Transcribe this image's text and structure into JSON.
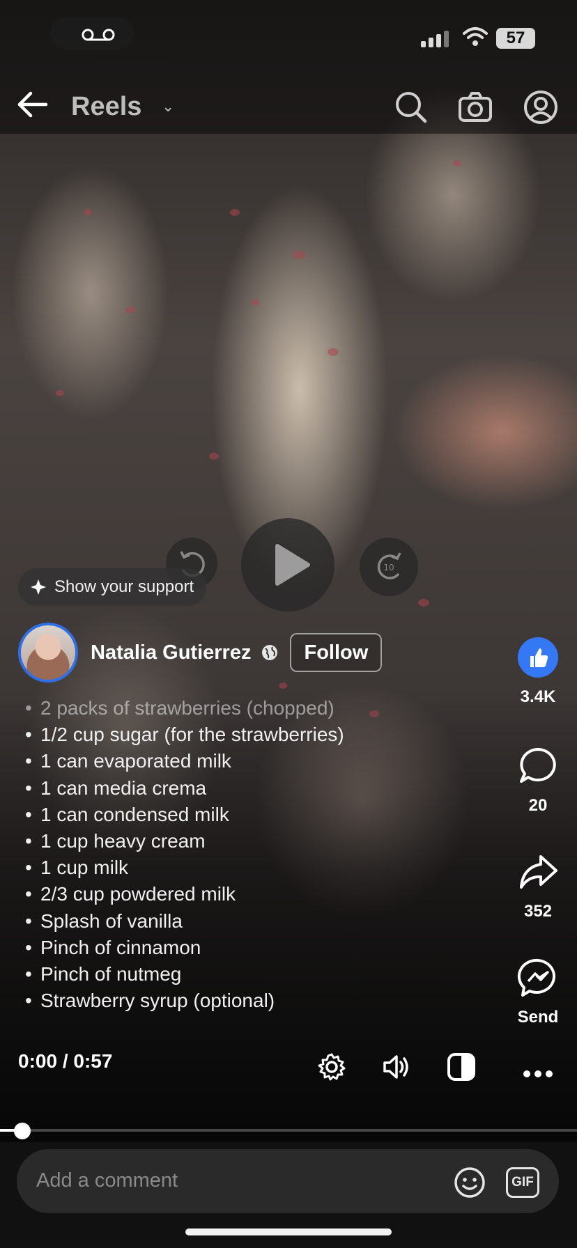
{
  "status_bar": {
    "battery": "57"
  },
  "header": {
    "title": "Reels",
    "caret": "⌄"
  },
  "support": {
    "label": "Show your support"
  },
  "author": {
    "name": "Natalia Gutierrez",
    "follow_label": "Follow"
  },
  "ingredients": [
    "2 packs of strawberries (chopped)",
    "1/2 cup sugar (for the strawberries)",
    "1 can evaporated milk",
    "1 can media crema",
    "1 can condensed milk",
    "1 cup heavy cream",
    "1 cup milk",
    "2/3 cup powdered milk",
    "Splash of vanilla",
    "Pinch of cinnamon",
    "Pinch of nutmeg",
    "Strawberry syrup (optional)"
  ],
  "bullet": "•",
  "rail": {
    "likes": "3.4K",
    "comments": "20",
    "shares": "352",
    "send_label": "Send"
  },
  "player": {
    "time": "0:00 / 0:57",
    "progress": 0.0,
    "skip_back_seconds": "10",
    "skip_forward_seconds": "10"
  },
  "comment": {
    "placeholder": "Add a comment",
    "gif_label": "GIF"
  },
  "colors": {
    "like_blue": "#3478f6",
    "avatar_ring": "#2f6fe6"
  }
}
